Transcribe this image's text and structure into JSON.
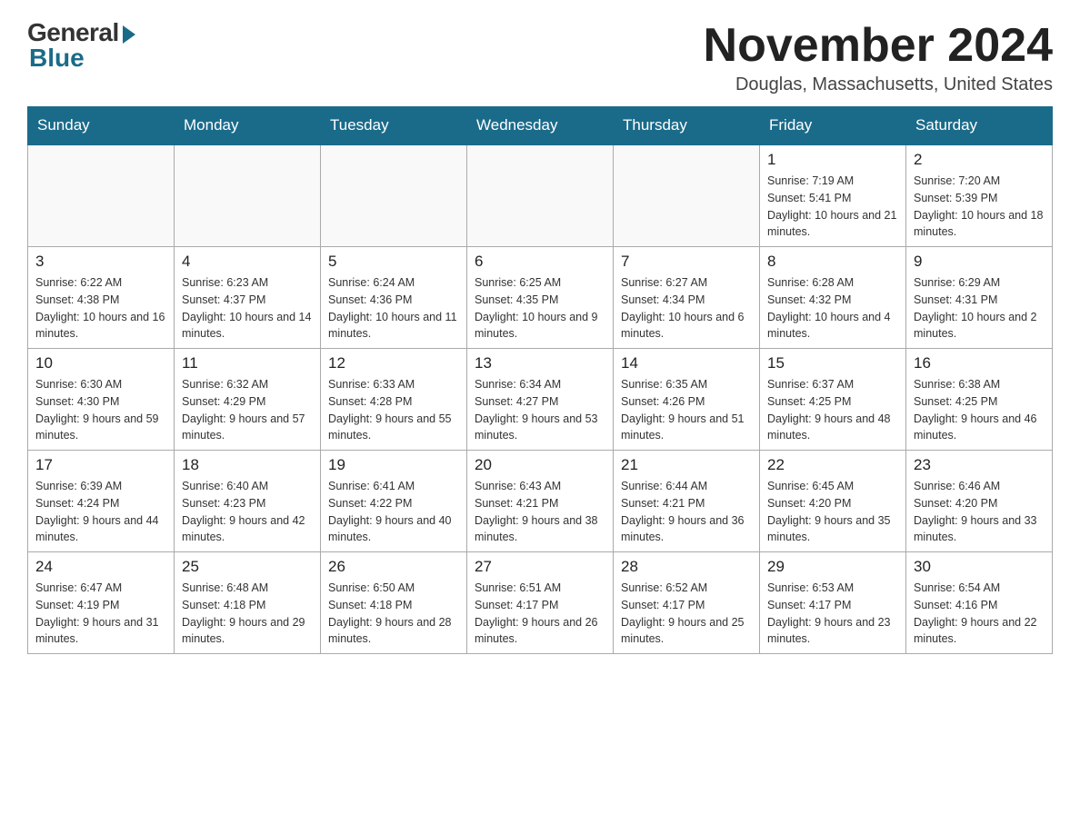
{
  "logo": {
    "general": "General",
    "blue": "Blue"
  },
  "title": "November 2024",
  "location": "Douglas, Massachusetts, United States",
  "days_of_week": [
    "Sunday",
    "Monday",
    "Tuesday",
    "Wednesday",
    "Thursday",
    "Friday",
    "Saturday"
  ],
  "weeks": [
    [
      {
        "day": "",
        "info": ""
      },
      {
        "day": "",
        "info": ""
      },
      {
        "day": "",
        "info": ""
      },
      {
        "day": "",
        "info": ""
      },
      {
        "day": "",
        "info": ""
      },
      {
        "day": "1",
        "info": "Sunrise: 7:19 AM\nSunset: 5:41 PM\nDaylight: 10 hours and 21 minutes."
      },
      {
        "day": "2",
        "info": "Sunrise: 7:20 AM\nSunset: 5:39 PM\nDaylight: 10 hours and 18 minutes."
      }
    ],
    [
      {
        "day": "3",
        "info": "Sunrise: 6:22 AM\nSunset: 4:38 PM\nDaylight: 10 hours and 16 minutes."
      },
      {
        "day": "4",
        "info": "Sunrise: 6:23 AM\nSunset: 4:37 PM\nDaylight: 10 hours and 14 minutes."
      },
      {
        "day": "5",
        "info": "Sunrise: 6:24 AM\nSunset: 4:36 PM\nDaylight: 10 hours and 11 minutes."
      },
      {
        "day": "6",
        "info": "Sunrise: 6:25 AM\nSunset: 4:35 PM\nDaylight: 10 hours and 9 minutes."
      },
      {
        "day": "7",
        "info": "Sunrise: 6:27 AM\nSunset: 4:34 PM\nDaylight: 10 hours and 6 minutes."
      },
      {
        "day": "8",
        "info": "Sunrise: 6:28 AM\nSunset: 4:32 PM\nDaylight: 10 hours and 4 minutes."
      },
      {
        "day": "9",
        "info": "Sunrise: 6:29 AM\nSunset: 4:31 PM\nDaylight: 10 hours and 2 minutes."
      }
    ],
    [
      {
        "day": "10",
        "info": "Sunrise: 6:30 AM\nSunset: 4:30 PM\nDaylight: 9 hours and 59 minutes."
      },
      {
        "day": "11",
        "info": "Sunrise: 6:32 AM\nSunset: 4:29 PM\nDaylight: 9 hours and 57 minutes."
      },
      {
        "day": "12",
        "info": "Sunrise: 6:33 AM\nSunset: 4:28 PM\nDaylight: 9 hours and 55 minutes."
      },
      {
        "day": "13",
        "info": "Sunrise: 6:34 AM\nSunset: 4:27 PM\nDaylight: 9 hours and 53 minutes."
      },
      {
        "day": "14",
        "info": "Sunrise: 6:35 AM\nSunset: 4:26 PM\nDaylight: 9 hours and 51 minutes."
      },
      {
        "day": "15",
        "info": "Sunrise: 6:37 AM\nSunset: 4:25 PM\nDaylight: 9 hours and 48 minutes."
      },
      {
        "day": "16",
        "info": "Sunrise: 6:38 AM\nSunset: 4:25 PM\nDaylight: 9 hours and 46 minutes."
      }
    ],
    [
      {
        "day": "17",
        "info": "Sunrise: 6:39 AM\nSunset: 4:24 PM\nDaylight: 9 hours and 44 minutes."
      },
      {
        "day": "18",
        "info": "Sunrise: 6:40 AM\nSunset: 4:23 PM\nDaylight: 9 hours and 42 minutes."
      },
      {
        "day": "19",
        "info": "Sunrise: 6:41 AM\nSunset: 4:22 PM\nDaylight: 9 hours and 40 minutes."
      },
      {
        "day": "20",
        "info": "Sunrise: 6:43 AM\nSunset: 4:21 PM\nDaylight: 9 hours and 38 minutes."
      },
      {
        "day": "21",
        "info": "Sunrise: 6:44 AM\nSunset: 4:21 PM\nDaylight: 9 hours and 36 minutes."
      },
      {
        "day": "22",
        "info": "Sunrise: 6:45 AM\nSunset: 4:20 PM\nDaylight: 9 hours and 35 minutes."
      },
      {
        "day": "23",
        "info": "Sunrise: 6:46 AM\nSunset: 4:20 PM\nDaylight: 9 hours and 33 minutes."
      }
    ],
    [
      {
        "day": "24",
        "info": "Sunrise: 6:47 AM\nSunset: 4:19 PM\nDaylight: 9 hours and 31 minutes."
      },
      {
        "day": "25",
        "info": "Sunrise: 6:48 AM\nSunset: 4:18 PM\nDaylight: 9 hours and 29 minutes."
      },
      {
        "day": "26",
        "info": "Sunrise: 6:50 AM\nSunset: 4:18 PM\nDaylight: 9 hours and 28 minutes."
      },
      {
        "day": "27",
        "info": "Sunrise: 6:51 AM\nSunset: 4:17 PM\nDaylight: 9 hours and 26 minutes."
      },
      {
        "day": "28",
        "info": "Sunrise: 6:52 AM\nSunset: 4:17 PM\nDaylight: 9 hours and 25 minutes."
      },
      {
        "day": "29",
        "info": "Sunrise: 6:53 AM\nSunset: 4:17 PM\nDaylight: 9 hours and 23 minutes."
      },
      {
        "day": "30",
        "info": "Sunrise: 6:54 AM\nSunset: 4:16 PM\nDaylight: 9 hours and 22 minutes."
      }
    ]
  ]
}
